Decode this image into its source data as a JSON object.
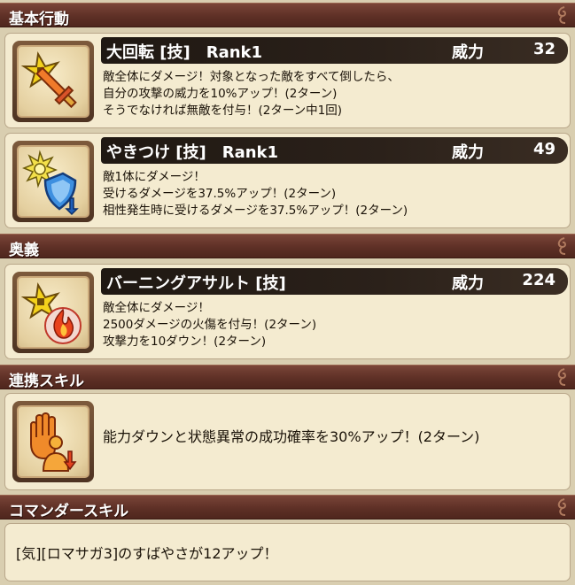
{
  "sections": {
    "basic": {
      "title": "基本行動"
    },
    "ougi": {
      "title": "奥義"
    },
    "renkei": {
      "title": "連携スキル"
    },
    "commander": {
      "title": "コマンダースキル"
    }
  },
  "power_label": "威力",
  "skills": [
    {
      "name": "大回転 [技]　Rank1",
      "power": "32",
      "icon": "shuriken-sword-icon",
      "lines": [
        "敵全体にダメージ！対象となった敵をすべて倒したら、",
        "自分の攻撃の威力を10%アップ！(2ターン)",
        "そうでなければ無敵を付与！(2ターン中1回)"
      ]
    },
    {
      "name": "やきつけ [技]　Rank1",
      "power": "49",
      "icon": "burst-shield-down-icon",
      "lines": [
        "敵1体にダメージ！",
        "受けるダメージを37.5%アップ！(2ターン)",
        "相性発生時に受けるダメージを37.5%アップ！(2ターン)"
      ]
    },
    {
      "name": "バーニングアサルト [技]",
      "power": "224",
      "icon": "shuriken-flame-icon",
      "lines": [
        "敵全体にダメージ！",
        "2500ダメージの火傷を付与！(2ターン)",
        "攻撃力を10ダウン！(2ターン)"
      ]
    }
  ],
  "renkei_skill": {
    "icon": "debuff-hand-icon",
    "text": "能力ダウンと状態異常の成功確率を30%アップ！(2ターン)"
  },
  "commander_skill": {
    "text": "[気][ロマサガ3]のすばやさが12アップ！"
  },
  "colors": {
    "header_bg": "#5e3026",
    "card_bg": "#f4ebd0",
    "name_bar_bg": "#1f1812"
  }
}
